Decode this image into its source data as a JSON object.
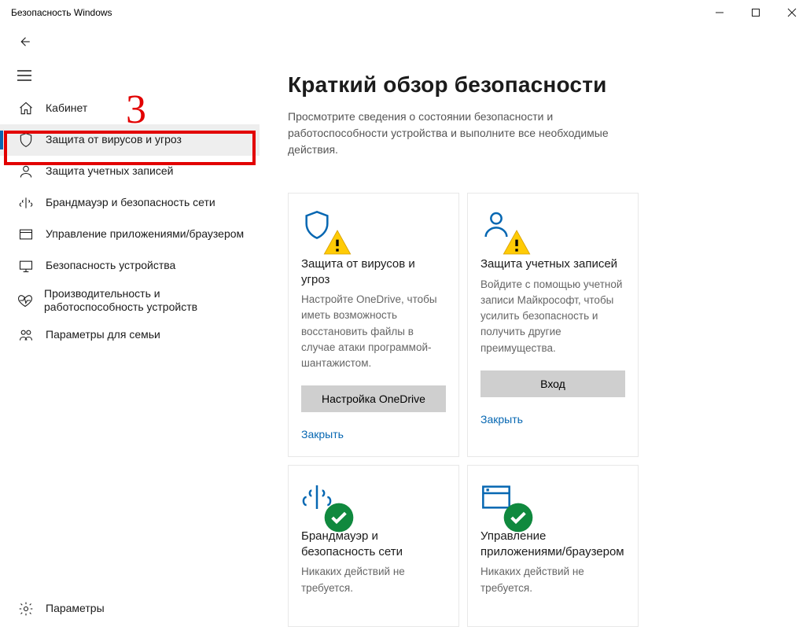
{
  "window": {
    "title": "Безопасность Windows"
  },
  "annotation": {
    "number": "3"
  },
  "sidebar": {
    "items": [
      {
        "label": "Кабинет"
      },
      {
        "label": "Защита от вирусов и угроз"
      },
      {
        "label": "Защита учетных записей"
      },
      {
        "label": "Брандмауэр и безопасность сети"
      },
      {
        "label": "Управление приложениями/браузером"
      },
      {
        "label": "Безопасность устройства"
      },
      {
        "label": "Производительность и работоспособность устройств"
      },
      {
        "label": "Параметры для семьи"
      }
    ],
    "bottom": {
      "label": "Параметры"
    }
  },
  "main": {
    "heading": "Краткий обзор безопасности",
    "subtitle": "Просмотрите сведения о состоянии безопасности и работоспособности устройства и выполните все необходимые действия."
  },
  "cards": [
    {
      "title": "Защита от вирусов и угроз",
      "desc": "Настройте OneDrive, чтобы иметь возможность восстановить файлы в случае атаки программой-шантажистом.",
      "button": "Настройка OneDrive",
      "link": "Закрыть",
      "status": "warn",
      "icon": "shield"
    },
    {
      "title": "Защита учетных записей",
      "desc": "Войдите с помощью учетной записи Майкрософт, чтобы усилить безопасность и получить другие преимущества.",
      "button": "Вход",
      "link": "Закрыть",
      "status": "warn",
      "icon": "account"
    },
    {
      "title": "Брандмауэр и безопасность сети",
      "desc": "Никаких действий не требуется.",
      "status": "ok",
      "icon": "firewall"
    },
    {
      "title": "Управление приложениями/браузером",
      "desc": "Никаких действий не требуется.",
      "status": "ok",
      "icon": "appbrowser"
    }
  ]
}
